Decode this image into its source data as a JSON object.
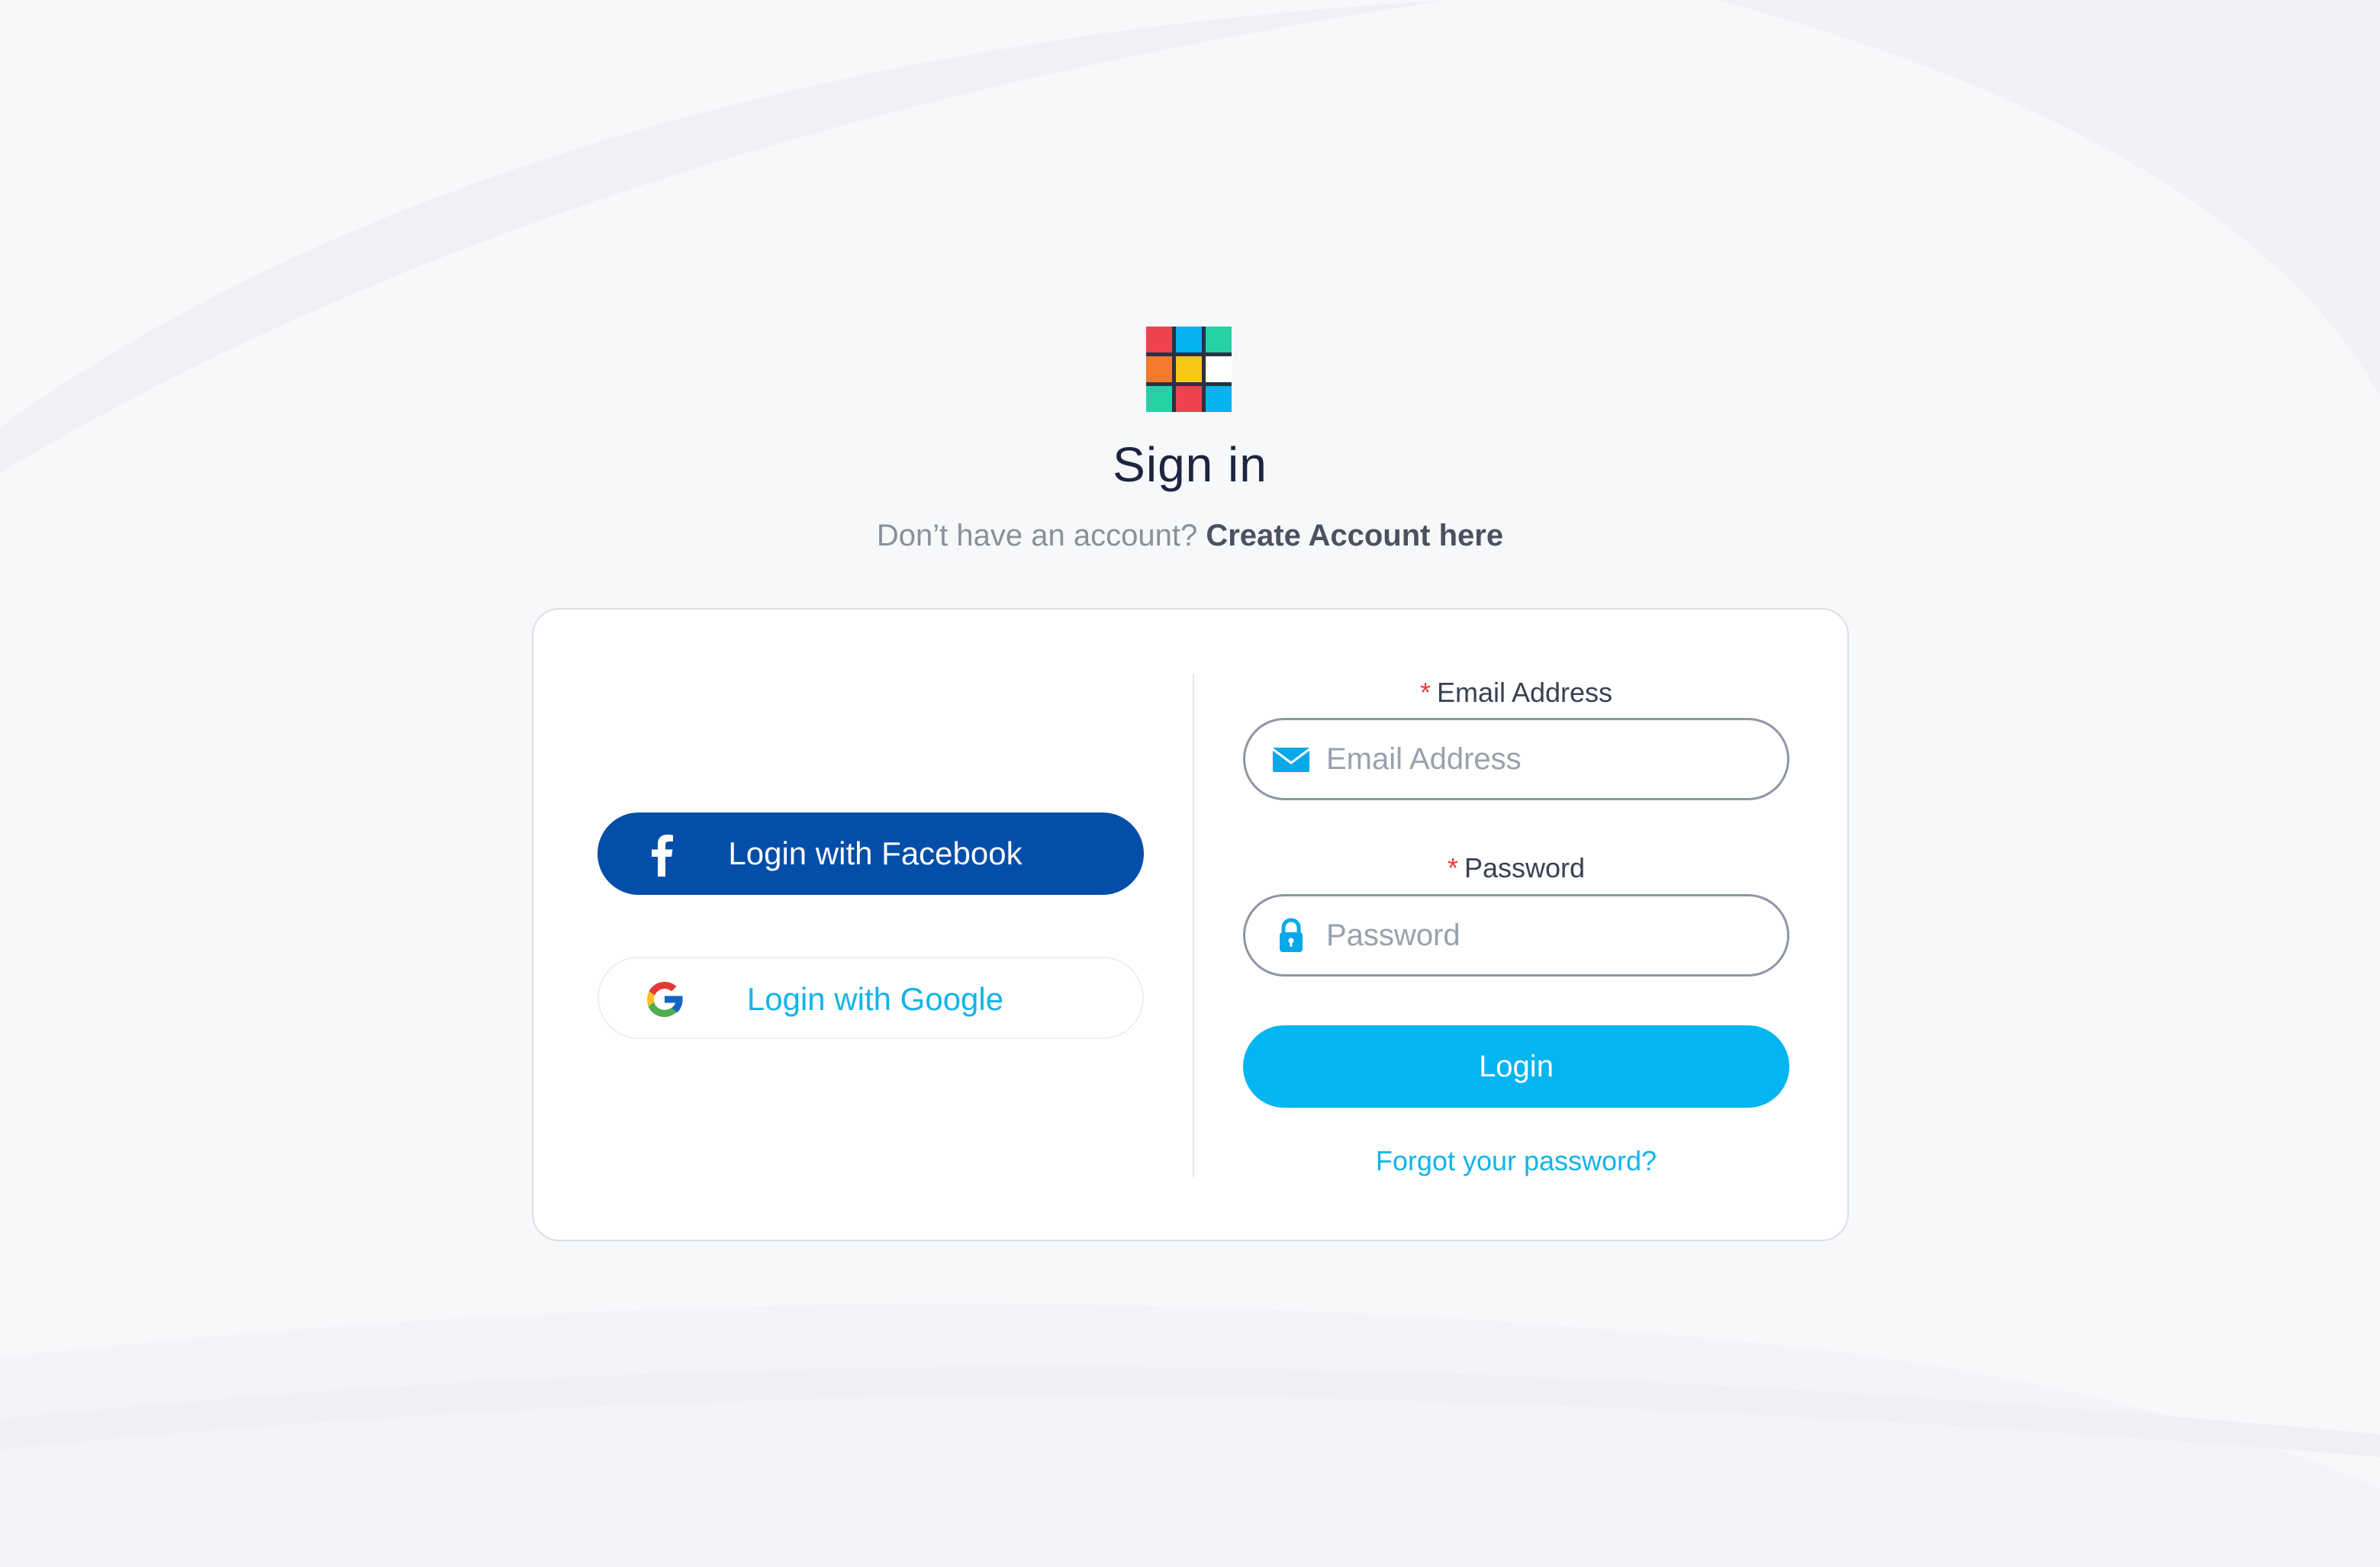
{
  "header": {
    "title": "Sign in",
    "subtitle_prefix": "Don’t have an account?",
    "create_account_link": "Create Account here"
  },
  "social": {
    "facebook_label": "Login with Facebook",
    "google_label": "Login with Google",
    "facebook_color": "#034ea8",
    "google_text_color": "#10b4e8"
  },
  "form": {
    "email_required_mark": "*",
    "email_label": "Email Address",
    "email_placeholder": "Email Address",
    "email_value": "",
    "password_required_mark": "*",
    "password_label": "Password",
    "password_placeholder": "Password",
    "password_value": "",
    "login_button": "Login",
    "forgot_link": "Forgot your password?"
  },
  "icons": {
    "logo": "grid-logo-icon",
    "facebook": "facebook-icon",
    "google": "google-icon",
    "email": "envelope-icon",
    "password": "lock-icon"
  },
  "colors": {
    "accent": "#03b5f0",
    "background": "#f7f8fa",
    "required": "#ef3b3b"
  }
}
